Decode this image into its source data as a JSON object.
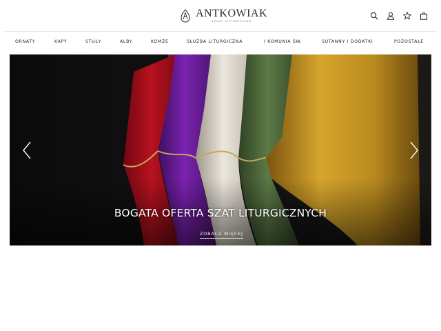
{
  "header": {
    "brand_name": "ANTKOWIAK",
    "brand_tagline": "SZATY LITURGICZNE",
    "icons": [
      "search-icon",
      "user-icon",
      "star-icon",
      "bag-icon"
    ]
  },
  "nav": {
    "items": [
      {
        "label": "ORNATY"
      },
      {
        "label": "KAPY"
      },
      {
        "label": "STUŁY"
      },
      {
        "label": "ALBY"
      },
      {
        "label": "KOMŻE"
      },
      {
        "label": "SŁUŻBA LITURGICZNA"
      },
      {
        "label": "I KOMUNIA ŚW."
      },
      {
        "label": "SUTANNY I DODATKI"
      },
      {
        "label": "POZOSTAŁE"
      }
    ]
  },
  "hero": {
    "title": "BOGATA OFERTA SZAT LITURGICZNYCH",
    "cta_label": "ZOBACZ WIĘCEJ",
    "prev_icon": "chevron-left-icon",
    "next_icon": "chevron-right-icon"
  },
  "colors": {
    "background": "#ffffff",
    "text": "#222222",
    "hero_red": "#b0101c",
    "hero_purple": "#6a1b9a",
    "hero_white": "#e8e4dc",
    "hero_green": "#4f6b3c",
    "hero_gold": "#c89b23"
  }
}
